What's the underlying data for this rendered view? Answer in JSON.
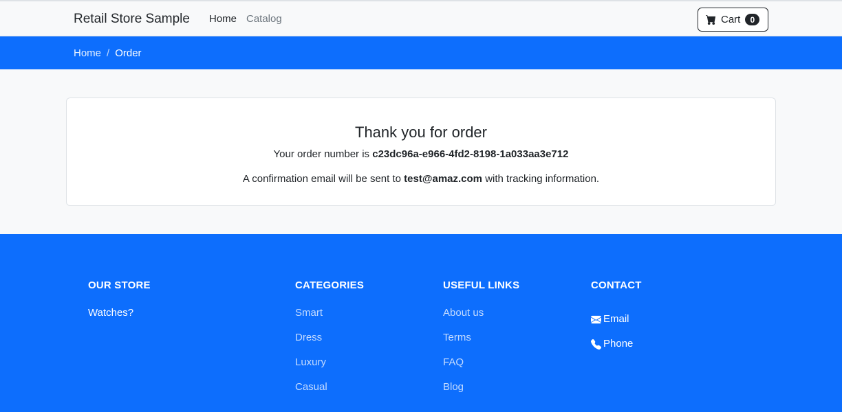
{
  "navbar": {
    "brand": "Retail Store Sample",
    "links": [
      "Home",
      "Catalog"
    ],
    "cart": {
      "label": "Cart",
      "count": "0"
    }
  },
  "breadcrumb": {
    "items": [
      "Home",
      "Order"
    ],
    "separator": "/"
  },
  "order": {
    "title": "Thank you for order",
    "number_prefix": "Your order number is",
    "number": "c23dc96a-e966-4fd2-8198-1a033aa3e712",
    "confirm_prefix": "A confirmation email will be sent to",
    "email": "test@amaz.com",
    "confirm_suffix": "with tracking information."
  },
  "footer": {
    "our_store": {
      "heading": "OUR STORE",
      "items": [
        "Watches?"
      ]
    },
    "categories": {
      "heading": "CATEGORIES",
      "items": [
        "Smart",
        "Dress",
        "Luxury",
        "Casual"
      ]
    },
    "useful_links": {
      "heading": "USEFUL LINKS",
      "items": [
        "About us",
        "Terms",
        "FAQ",
        "Blog"
      ]
    },
    "contact": {
      "heading": "CONTACT",
      "items": [
        {
          "icon": "envelope-icon",
          "label": "Email"
        },
        {
          "icon": "phone-icon",
          "label": "Phone"
        }
      ]
    }
  },
  "colors": {
    "primary": "#0d6efd",
    "navbar_bg": "#f8f9fa",
    "text": "#212529"
  }
}
